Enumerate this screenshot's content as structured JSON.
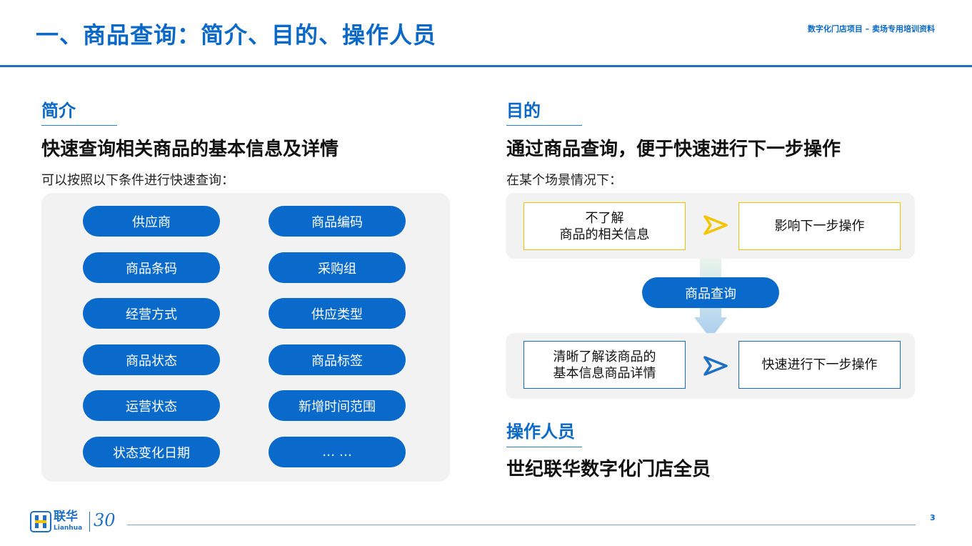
{
  "header": {
    "title": "一、商品查询：简介、目的、操作人员",
    "project": "数字化门店项目 – 卖场专用培训资料"
  },
  "intro": {
    "heading": "简介",
    "headline": "快速查询相关商品的基本信息及详情",
    "subtext": "可以按照以下条件进行快速查询：",
    "conditions": [
      "供应商",
      "商品编码",
      "商品条码",
      "采购组",
      "经营方式",
      "供应类型",
      "商品状态",
      "商品标签",
      "运营状态",
      "新增时间范围",
      "状态变化日期",
      "… …"
    ]
  },
  "purpose": {
    "heading": "目的",
    "headline": "通过商品查询，便于快速进行下一步操作",
    "subtext": "在某个场景情况下：",
    "before_line1": "不了解",
    "before_line2": "商品的相关信息",
    "before_result": "影响下一步操作",
    "action": "商品查询",
    "after_line1": "清晰了解该商品的",
    "after_line2": "基本信息商品详情",
    "after_result": "快速进行下一步操作",
    "colors": {
      "before_arrow": "#f5c400",
      "after_arrow": "#1f6fc4",
      "before_border": "#f0c000",
      "after_border": "#1a6bb8"
    }
  },
  "operators": {
    "heading": "操作人员",
    "headline": "世纪联华数字化门店全员"
  },
  "footer": {
    "logo_text": "联华",
    "logo_sub": "Lianhua",
    "anniversary": "30",
    "page_number": "3"
  },
  "icons": [
    "arrow-right-icon",
    "arrow-down-icon",
    "lianhua-logo-icon"
  ]
}
